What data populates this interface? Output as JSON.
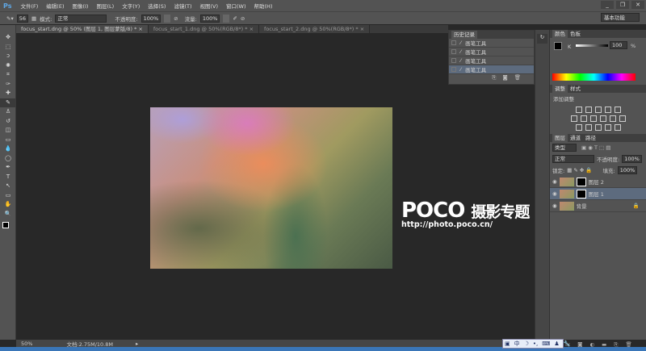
{
  "app": {
    "logo": "Ps",
    "menus": [
      "文件(F)",
      "编辑(E)",
      "图像(I)",
      "图层(L)",
      "文字(Y)",
      "选择(S)",
      "滤镜(T)",
      "视图(V)",
      "窗口(W)",
      "帮助(H)"
    ],
    "window_buttons": [
      "_",
      "❐",
      "✕"
    ]
  },
  "options": {
    "brush_size": "56",
    "mode_label": "模式:",
    "mode_value": "正常",
    "opacity_label": "不透明度:",
    "opacity_value": "100%",
    "flow_label": "流量:",
    "flow_value": "100%",
    "workspace": "基本功能"
  },
  "tabs": [
    "focus_start.dng @ 50% (图层 1, 图层蒙版/8) * ×",
    "focus_start_1.dng @ 50%(RGB/8*) * ×",
    "focus_start_2.dng @ 50%(RGB/8*) * ×"
  ],
  "tools": [
    "move-icon",
    "marquee-icon",
    "lasso-icon",
    "quick-select-icon",
    "crop-icon",
    "eyedropper-icon",
    "healing-icon",
    "brush-icon",
    "stamp-icon",
    "history-brush-icon",
    "eraser-icon",
    "gradient-icon",
    "blur-icon",
    "dodge-icon",
    "pen-icon",
    "type-icon",
    "path-select-icon",
    "shape-icon",
    "hand-icon",
    "zoom-icon"
  ],
  "watermark": {
    "brand": "POCO",
    "title": "摄影专题",
    "url": "http://photo.poco.cn/"
  },
  "history": {
    "title": "历史记录",
    "items": [
      "画笔工具",
      "画笔工具",
      "画笔工具",
      "画笔工具"
    ],
    "selected": 3
  },
  "color": {
    "tabs": [
      "颜色",
      "色板"
    ],
    "channel": "K",
    "value": "100",
    "unit": "%"
  },
  "adjustments": {
    "tabs": [
      "调整",
      "样式"
    ],
    "heading": "添加调整"
  },
  "layers": {
    "tabs": [
      "图层",
      "通道",
      "路径"
    ],
    "filter": "类型",
    "blend": "正常",
    "opacity_label": "不透明度:",
    "opacity": "100%",
    "lock_label": "锁定:",
    "fill_label": "填充:",
    "fill": "100%",
    "items": [
      {
        "name": "图层 2",
        "mask": true
      },
      {
        "name": "图层 1",
        "mask": true,
        "selected": true
      },
      {
        "name": "背景",
        "locked": true
      }
    ]
  },
  "status": {
    "zoom": "50%",
    "doc": "文档:2.75M/10.8M"
  },
  "ime": [
    "中",
    "☽",
    "•,",
    "⌨",
    "♟",
    "🔧"
  ]
}
